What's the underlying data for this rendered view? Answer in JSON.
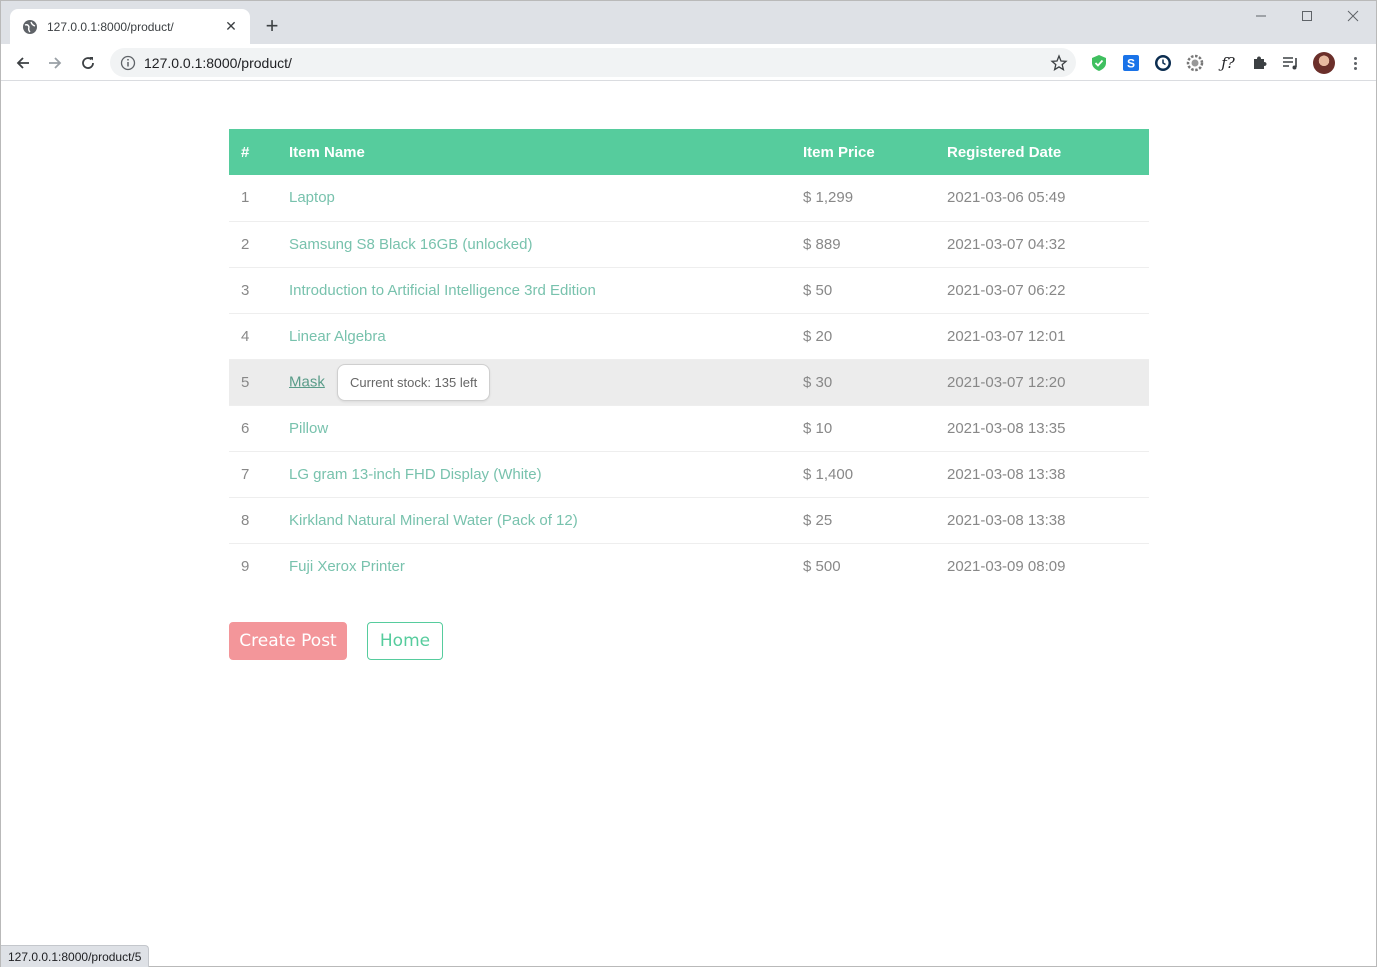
{
  "browser": {
    "tab_title": "127.0.0.1:8000/product/",
    "url": "127.0.0.1:8000/product/",
    "status_url": "127.0.0.1:8000/product/5"
  },
  "table": {
    "headers": [
      "#",
      "Item Name",
      "Item Price",
      "Registered Date"
    ],
    "rows": [
      {
        "num": "1",
        "name": "Laptop",
        "price": "$ 1,299",
        "date": "2021-03-06 05:49"
      },
      {
        "num": "2",
        "name": "Samsung S8 Black 16GB (unlocked)",
        "price": "$ 889",
        "date": "2021-03-07 04:32"
      },
      {
        "num": "3",
        "name": "Introduction to Artificial Intelligence 3rd Edition",
        "price": "$ 50",
        "date": "2021-03-07 06:22"
      },
      {
        "num": "4",
        "name": "Linear Algebra",
        "price": "$ 20",
        "date": "2021-03-07 12:01"
      },
      {
        "num": "5",
        "name": "Mask",
        "price": "$ 30",
        "date": "2021-03-07 12:20"
      },
      {
        "num": "6",
        "name": "Pillow",
        "price": "$ 10",
        "date": "2021-03-08 13:35"
      },
      {
        "num": "7",
        "name": "LG gram 13-inch FHD Display (White)",
        "price": "$ 1,400",
        "date": "2021-03-08 13:38"
      },
      {
        "num": "8",
        "name": "Kirkland Natural Mineral Water (Pack of 12)",
        "price": "$ 25",
        "date": "2021-03-08 13:38"
      },
      {
        "num": "9",
        "name": "Fuji Xerox Printer",
        "price": "$ 500",
        "date": "2021-03-09 08:09"
      }
    ],
    "tooltip": "Current stock: 135 left"
  },
  "buttons": {
    "create": "Create Post",
    "home": "Home"
  },
  "colors": {
    "header_bg": "#56cc9d",
    "link": "#78c2ad",
    "create_bg": "#f3969a",
    "home_border": "#56cc9d"
  }
}
